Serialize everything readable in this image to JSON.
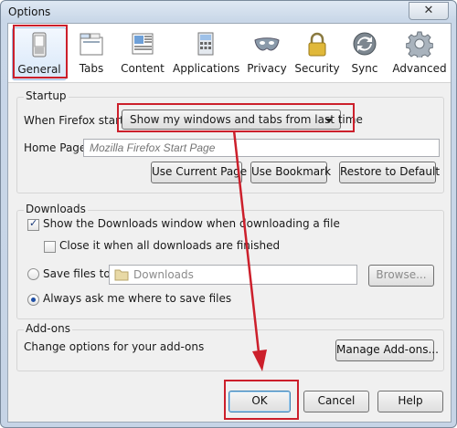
{
  "window": {
    "title": "Options",
    "close_symbol": "✕"
  },
  "toolbar": {
    "tabs": [
      {
        "label": "General",
        "icon": "switch-icon",
        "selected": true
      },
      {
        "label": "Tabs",
        "icon": "tabs-icon"
      },
      {
        "label": "Content",
        "icon": "content-icon"
      },
      {
        "label": "Applications",
        "icon": "applications-icon"
      },
      {
        "label": "Privacy",
        "icon": "mask-icon"
      },
      {
        "label": "Security",
        "icon": "padlock-icon"
      },
      {
        "label": "Sync",
        "icon": "sync-icon"
      },
      {
        "label": "Advanced",
        "icon": "gear-icon"
      }
    ]
  },
  "startup": {
    "group_label": "Startup",
    "when_starts_label": "When Firefox starts:",
    "when_starts_value": "Show my windows and tabs from last time",
    "home_page_label": "Home Page:",
    "home_page_placeholder": "Mozilla Firefox Start Page",
    "use_current_page": "Use Current Page",
    "use_bookmark": "Use Bookmark",
    "restore_default": "Restore to Default"
  },
  "downloads": {
    "group_label": "Downloads",
    "show_window_label": "Show the Downloads window when downloading a file",
    "show_window_checked": true,
    "close_it_label": "Close it when all downloads are finished",
    "close_it_checked": false,
    "save_files_label": "Save files to",
    "save_folder": "Downloads",
    "browse": "Browse...",
    "always_ask_label": "Always ask me where to save files",
    "selected_option": "always_ask"
  },
  "addons": {
    "group_label": "Add-ons",
    "description": "Change options for your add-ons",
    "manage": "Manage Add-ons..."
  },
  "footer": {
    "ok": "OK",
    "cancel": "Cancel",
    "help": "Help"
  },
  "colors": {
    "highlight_red": "#cc1f2b",
    "accent_blue": "#1f4fa5"
  }
}
